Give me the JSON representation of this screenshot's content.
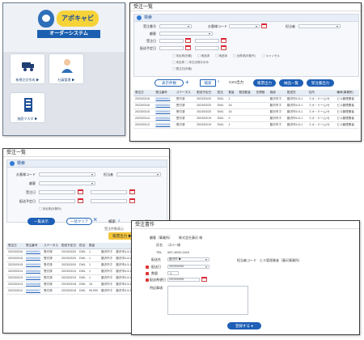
{
  "menu": {
    "logo_text": "アポキャビ",
    "band": "オーダーシステム",
    "tiles": [
      {
        "label": "新規注文作成 ▶"
      },
      {
        "label": "社員管理 ▶"
      },
      {
        "label": "施設マスタ ▶"
      }
    ]
  },
  "list1": {
    "title": "受注一覧",
    "panel_title": "検索",
    "labels": {
      "l1": "受注番号",
      "l2": "顧客",
      "l3": "受注日",
      "l4": "配送予定日",
      "l5": "お客様コード",
      "l6": "担当者",
      "l7": "施設"
    },
    "checks": [
      "▢ 未出荷(対象)",
      "▢ 納品済",
      "▢ 納品待",
      "▢ 出荷済(対象外)",
      "▢ キャンセル"
    ],
    "checks2": "▢ 未出荷 ▢ 本日出荷分のみ",
    "buttons": {
      "export": "CSV出力",
      "b1": "帳票出力",
      "b2": "納品一覧",
      "b3": "受注書出力",
      "search": "検索"
    },
    "count_label": "表示件数",
    "headers": [
      "受注日",
      "受注番号",
      "ステータス",
      "配送予定日",
      "担当",
      "数量",
      "発送数量",
      "在庫数",
      "施設",
      "配送先",
      "住所",
      "備考(事業所)"
    ],
    "rows": [
      [
        "2023/03/16",
        "000000001",
        "受付済",
        "2023/03/20",
        "DWL",
        "1",
        "",
        "",
        "藤沢市ホ",
        "藤沢市4-5-1",
        "ミオ・ドーム/セ",
        "ビル管理業者"
      ],
      [
        "2023/03/16",
        "000000002",
        "受付済",
        "2023/03/20",
        "DWL",
        "16",
        "",
        "",
        "藤沢市ホ",
        "藤沢市4-5-1",
        "ミオ・ドーム/セ",
        "ビル管理業者"
      ],
      [
        "2023/03/15",
        "000000003",
        "受付済",
        "2023/03/20",
        "DWL",
        "16",
        "",
        "",
        "藤沢市ホ",
        "藤沢市4-5-1",
        "ミオ・ドーム/セ",
        "ビル管理業者"
      ],
      [
        "2023/03/14",
        "000000004",
        "受付済",
        "2023/03/19",
        "DWL",
        "2",
        "",
        "",
        "藤沢市ホ",
        "藤沢市4-5-1",
        "ミオ・ドーム/セ",
        "ビル管理業者"
      ],
      [
        "2023/03/13",
        "000000005",
        "受付済",
        "2023/03/19",
        "DWL",
        "1",
        "",
        "",
        "藤沢市ホ",
        "藤沢市4-5-1",
        "ミオ・ドーム/セ",
        "ビル管理業者"
      ]
    ]
  },
  "list2": {
    "title": "受注一覧",
    "panel_title": "検索",
    "labels": {
      "l1": "お客様コード",
      "l2": "顧客",
      "l3": "受注日",
      "l4": "配送予定日",
      "l5": "担当者"
    },
    "checks": "▢ 未出荷(対象外)",
    "buttons": {
      "list": "一覧表示",
      "clear": "一括クリア",
      "search": "検索",
      "export": "CSV出力",
      "y1": "帳票出力 ▶",
      "y2": "受注表 ▶"
    },
    "count_label": "受注件数表示",
    "headers": [
      "受注日",
      "受注番号",
      "ステータス",
      "配送予定日",
      "担当",
      "数量"
    ],
    "rows": [
      [
        "2023/03/16",
        "000000001",
        "受付済",
        "2023/03/20",
        "DWL",
        "1"
      ],
      [
        "2023/03/15",
        "000000002",
        "受付済",
        "2023/03/20",
        "DWL",
        "1"
      ],
      [
        "2023/03/15",
        "000000003",
        "受付済",
        "2023/03/20",
        "DWL",
        "1"
      ],
      [
        "2023/03/14",
        "000000004",
        "受付済",
        "2023/03/19",
        "DWL",
        "1"
      ],
      [
        "2023/03/13",
        "000000005",
        "受付済",
        "2023/03/19",
        "DWL",
        "1"
      ],
      [
        "2023/03/13",
        "000000006",
        "受付済",
        "2023/03/18",
        "DWL",
        "16"
      ],
      [
        "2023/03/12",
        "000000007",
        "受付済",
        "2023/03/18",
        "DWL",
        "99,999"
      ]
    ],
    "addr": [
      "藤沢市ホ",
      "藤沢市4-5-1",
      "ミオ・ドーム/セ",
      "ビル管理業者"
    ]
  },
  "form": {
    "title": "受注書作",
    "fields": {
      "f1_label": "顧客（事業所）",
      "f1_value": "株式会社藤沢 様",
      "f2_label": "氏名",
      "f2_value": "ゴロー様",
      "f3_label": "TEL",
      "f3_value": "087-4594-1154",
      "f4_label": "配送先",
      "f4_value": "藤沢市 ▶",
      "f5_label": "担当者コード",
      "f5_value": "ビル管理業者（藤沢事業所）",
      "f6_label": "配送日",
      "f6_value": "2023/04/06",
      "f7_label": "数量",
      "f7_value": "1",
      "f8_label": "配送希望日",
      "f8_value": "2023/04/06",
      "f9_label": "特記事項"
    },
    "submit": "登録する"
  }
}
